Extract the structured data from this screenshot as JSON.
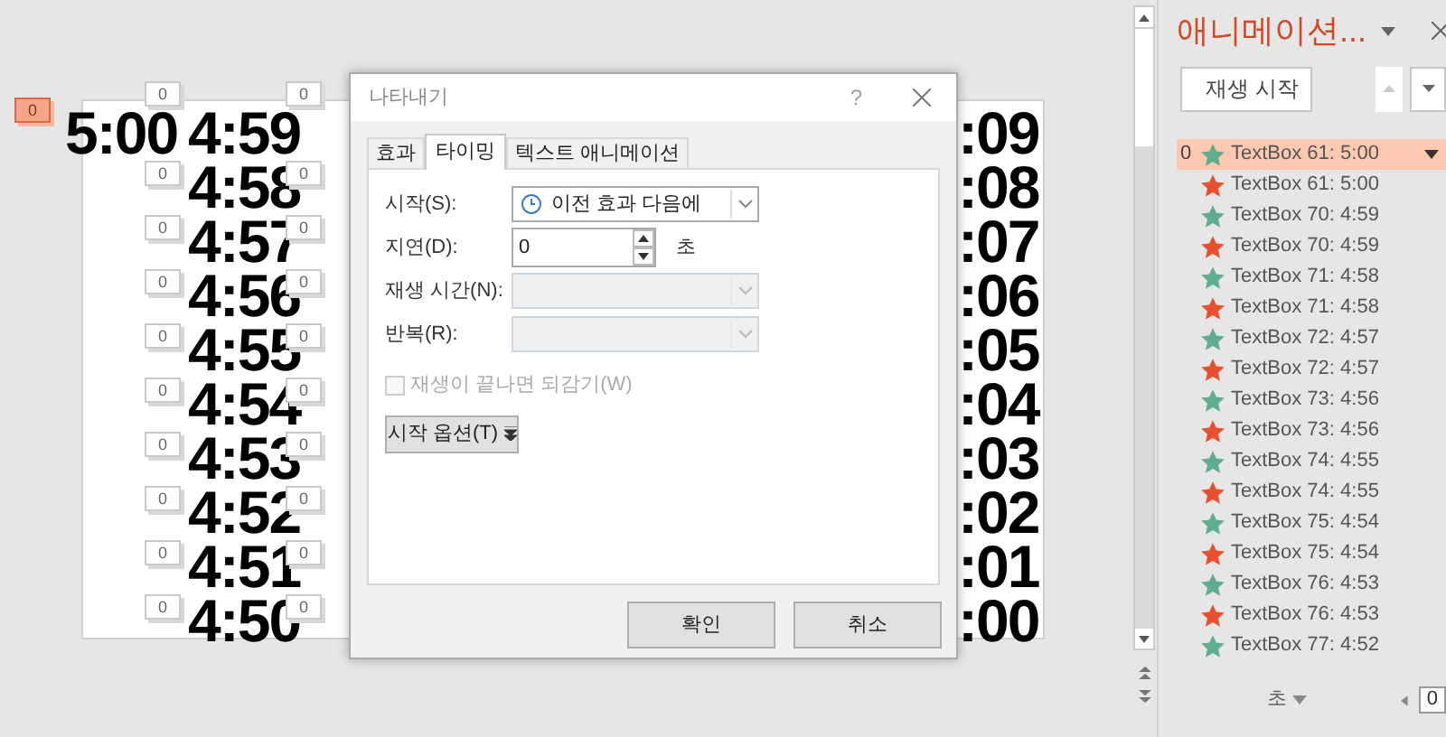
{
  "slide": {
    "marker": "0",
    "rows": [
      {
        "lead": "5:00",
        "tag_a": "0",
        "time": "4:59",
        "tag_b": "0",
        "right": ":09"
      },
      {
        "tag_a": "0",
        "time": "4:58",
        "tag_b": "0",
        "right": ":08"
      },
      {
        "tag_a": "0",
        "time": "4:57",
        "tag_b": "0",
        "right": ":07"
      },
      {
        "tag_a": "0",
        "time": "4:56",
        "tag_b": "0",
        "right": ":06"
      },
      {
        "tag_a": "0",
        "time": "4:55",
        "tag_b": "0",
        "right": ":05"
      },
      {
        "tag_a": "0",
        "time": "4:54",
        "tag_b": "0",
        "right": ":04"
      },
      {
        "tag_a": "0",
        "time": "4:53",
        "tag_b": "0",
        "right": ":03"
      },
      {
        "tag_a": "0",
        "time": "4:52",
        "tag_b": "0",
        "right": ":02"
      },
      {
        "tag_a": "0",
        "time": "4:51",
        "tag_b": "0",
        "right": ":01"
      },
      {
        "tag_a": "0",
        "time": "4:50",
        "tag_b": "0",
        "right": ":00"
      }
    ]
  },
  "dialog": {
    "title": "나타내기",
    "help": "?",
    "tabs": [
      {
        "label": "효과",
        "selected": false
      },
      {
        "label": "타이밍",
        "selected": true
      },
      {
        "label": "텍스트 애니메이션",
        "selected": false
      }
    ],
    "fields": [
      {
        "kind": "dropdown",
        "label": "시작(S):",
        "value": "이전 효과 다음에",
        "disabled": false
      },
      {
        "kind": "spinner",
        "label": "지연(D):",
        "value": "0",
        "unit": "초"
      },
      {
        "kind": "dropdown",
        "label": "재생 시간(N):",
        "disabled": true
      },
      {
        "kind": "dropdown",
        "label": "반복(R):",
        "disabled": true
      }
    ],
    "rewind": {
      "label": "재생이 끝나면 되감기(W)",
      "checked": false,
      "disabled": true
    },
    "options_button": "시작 옵션(T)",
    "buttons": [
      "확인",
      "취소"
    ]
  },
  "pane": {
    "title": "애니메이션...",
    "play_button": "재생 시작",
    "items": [
      {
        "number": "0",
        "selected": true,
        "color": "#5fad8e",
        "label": "TextBox 61: 5:00"
      },
      {
        "selected": false,
        "color": "#e8512f",
        "label": "TextBox 61: 5:00"
      },
      {
        "selected": false,
        "color": "#5fad8e",
        "label": "TextBox 70: 4:59"
      },
      {
        "selected": false,
        "color": "#e8512f",
        "label": "TextBox 70: 4:59"
      },
      {
        "selected": false,
        "color": "#5fad8e",
        "label": "TextBox 71: 4:58"
      },
      {
        "selected": false,
        "color": "#e8512f",
        "label": "TextBox 71: 4:58"
      },
      {
        "selected": false,
        "color": "#5fad8e",
        "label": "TextBox 72: 4:57"
      },
      {
        "selected": false,
        "color": "#e8512f",
        "label": "TextBox 72: 4:57"
      },
      {
        "selected": false,
        "color": "#5fad8e",
        "label": "TextBox 73: 4:56"
      },
      {
        "selected": false,
        "color": "#e8512f",
        "label": "TextBox 73: 4:56"
      },
      {
        "selected": false,
        "color": "#5fad8e",
        "label": "TextBox 74: 4:55"
      },
      {
        "selected": false,
        "color": "#e8512f",
        "label": "TextBox 74: 4:55"
      },
      {
        "selected": false,
        "color": "#5fad8e",
        "label": "TextBox 75: 4:54"
      },
      {
        "selected": false,
        "color": "#e8512f",
        "label": "TextBox 75: 4:54"
      },
      {
        "selected": false,
        "color": "#5fad8e",
        "label": "TextBox 76: 4:53"
      },
      {
        "selected": false,
        "color": "#e8512f",
        "label": "TextBox 76: 4:53"
      },
      {
        "selected": false,
        "color": "#5fad8e",
        "label": "TextBox 77: 4:52"
      }
    ],
    "footer": {
      "unit": "초",
      "page": "0"
    }
  }
}
